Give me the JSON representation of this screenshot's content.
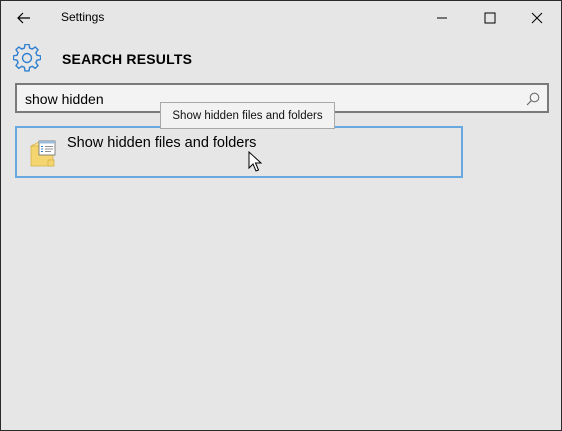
{
  "window": {
    "title": "Settings"
  },
  "header": {
    "title": "SEARCH RESULTS",
    "icon": "gear-icon",
    "accent": "#2f7fd1"
  },
  "search": {
    "value": "show hidden",
    "icon": "search-icon"
  },
  "tooltip": {
    "text": "Show hidden files and folders"
  },
  "results": [
    {
      "label": "Show hidden files and folders",
      "icon": "folder-options-icon"
    }
  ],
  "colors": {
    "background": "#e6e6e6",
    "selection_border": "#6aa9e0",
    "search_border": "#7a7a7a"
  }
}
